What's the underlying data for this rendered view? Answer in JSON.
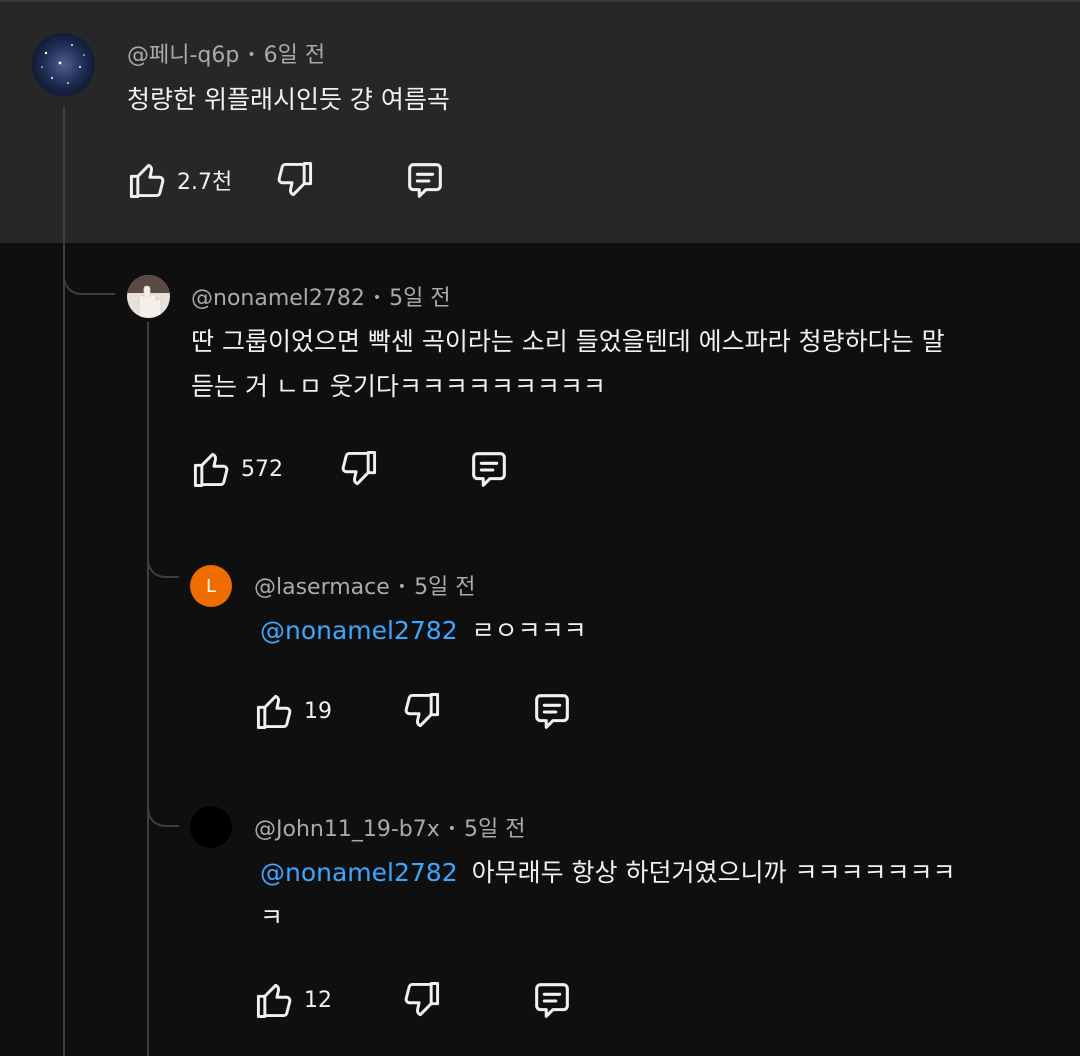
{
  "comments": [
    {
      "author": "@페니-q6p",
      "time": "6일 전",
      "text": "청량한 위플래시인듯 걍 여름곡",
      "likes": "2.7천"
    },
    {
      "author": "@nonamel2782",
      "time": "5일 전",
      "text_line1": "딴 그룹이었으면 빡센 곡이라는 소리 들었을텐데 에스파라 청량하다는 말",
      "text_line2": "듣는 거 ㄴㅁ 웃기다ㅋㅋㅋㅋㅋㅋㅋㅋㅋ",
      "likes": "572"
    },
    {
      "author": "@lasermace",
      "avatar_letter": "L",
      "time": "5일 전",
      "mention": "@nonamel2782",
      "text": "ㄹㅇㅋㅋㅋ",
      "likes": "19"
    },
    {
      "author": "@John11_19-b7x",
      "time": "5일 전",
      "mention": "@nonamel2782",
      "text_line1": "아무래두 항상 하던거였으니까 ㅋㅋㅋㅋㅋㅋㅋ",
      "text_line2": "ㅋ",
      "likes": "12"
    }
  ],
  "icons": {
    "like": "thumbs-up-icon",
    "dislike": "thumbs-down-icon",
    "reply": "reply-comment-icon"
  },
  "colors": {
    "background": "#0f0f0f",
    "highlight": "#272727",
    "mention": "#3ea6ff",
    "lasermace_avatar": "#ef6c00"
  }
}
